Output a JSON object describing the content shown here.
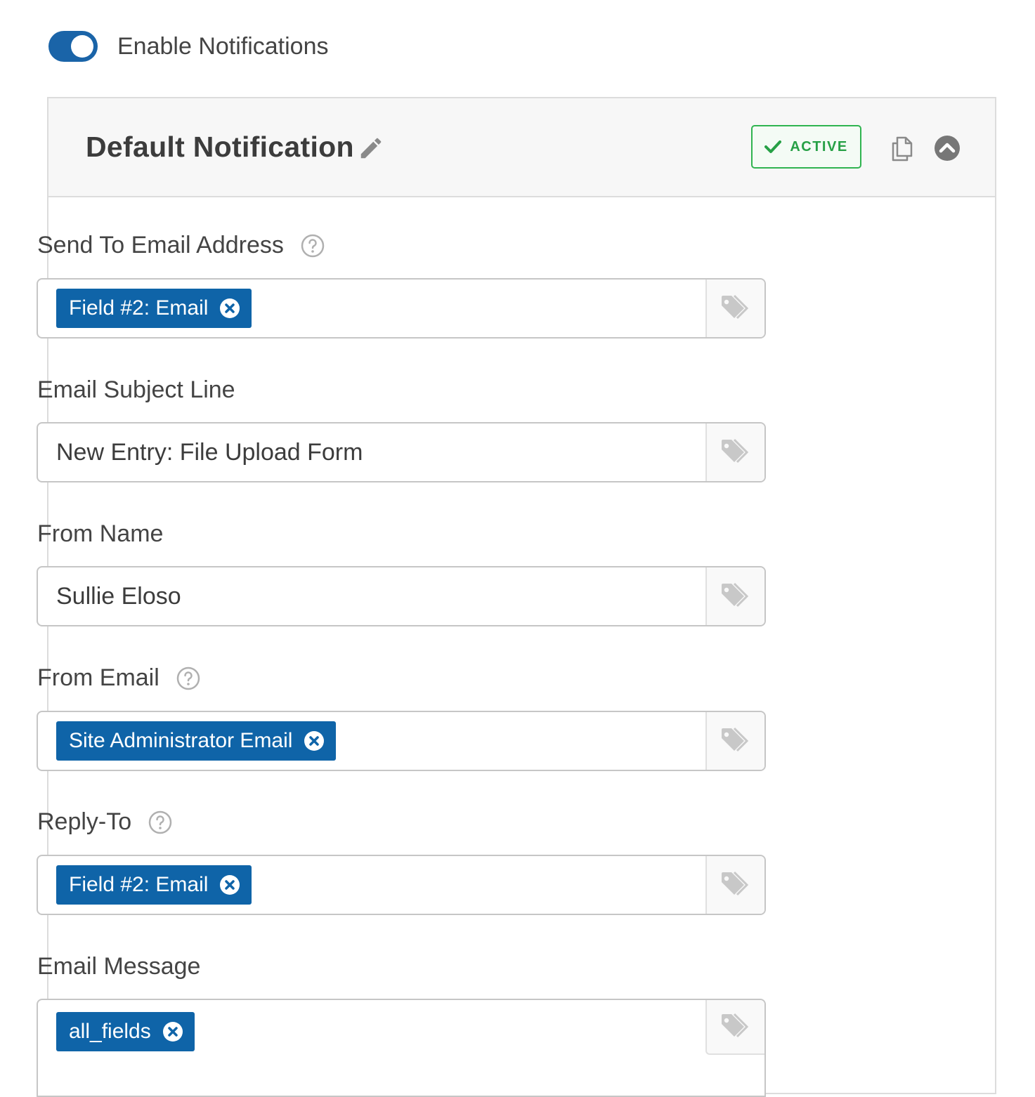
{
  "enable_notifications": {
    "label": "Enable Notifications",
    "enabled": true,
    "toggle_color": "#1a64a8"
  },
  "notification": {
    "title": "Default Notification",
    "status_badge": "ACTIVE",
    "status_color": "#30b450",
    "icons": {
      "edit": "pencil-icon",
      "status": "checkmark-icon",
      "duplicate": "copy-icon",
      "collapse": "chevron-up-circle-icon"
    }
  },
  "fields": {
    "send_to": {
      "label": "Send To Email Address",
      "chip": "Field #2: Email"
    },
    "subject": {
      "label": "Email Subject Line",
      "value": "New Entry: File Upload Form"
    },
    "from_name": {
      "label": "From Name",
      "value": "Sullie Eloso"
    },
    "from_email": {
      "label": "From Email",
      "chip": "Site Administrator Email"
    },
    "reply_to": {
      "label": "Reply-To",
      "chip": "Field #2: Email"
    },
    "message": {
      "label": "Email Message",
      "chip": "all_fields"
    }
  },
  "colors": {
    "chip_background": "#0f64a8",
    "border": "#c6c6c6",
    "label_text": "#444444"
  }
}
